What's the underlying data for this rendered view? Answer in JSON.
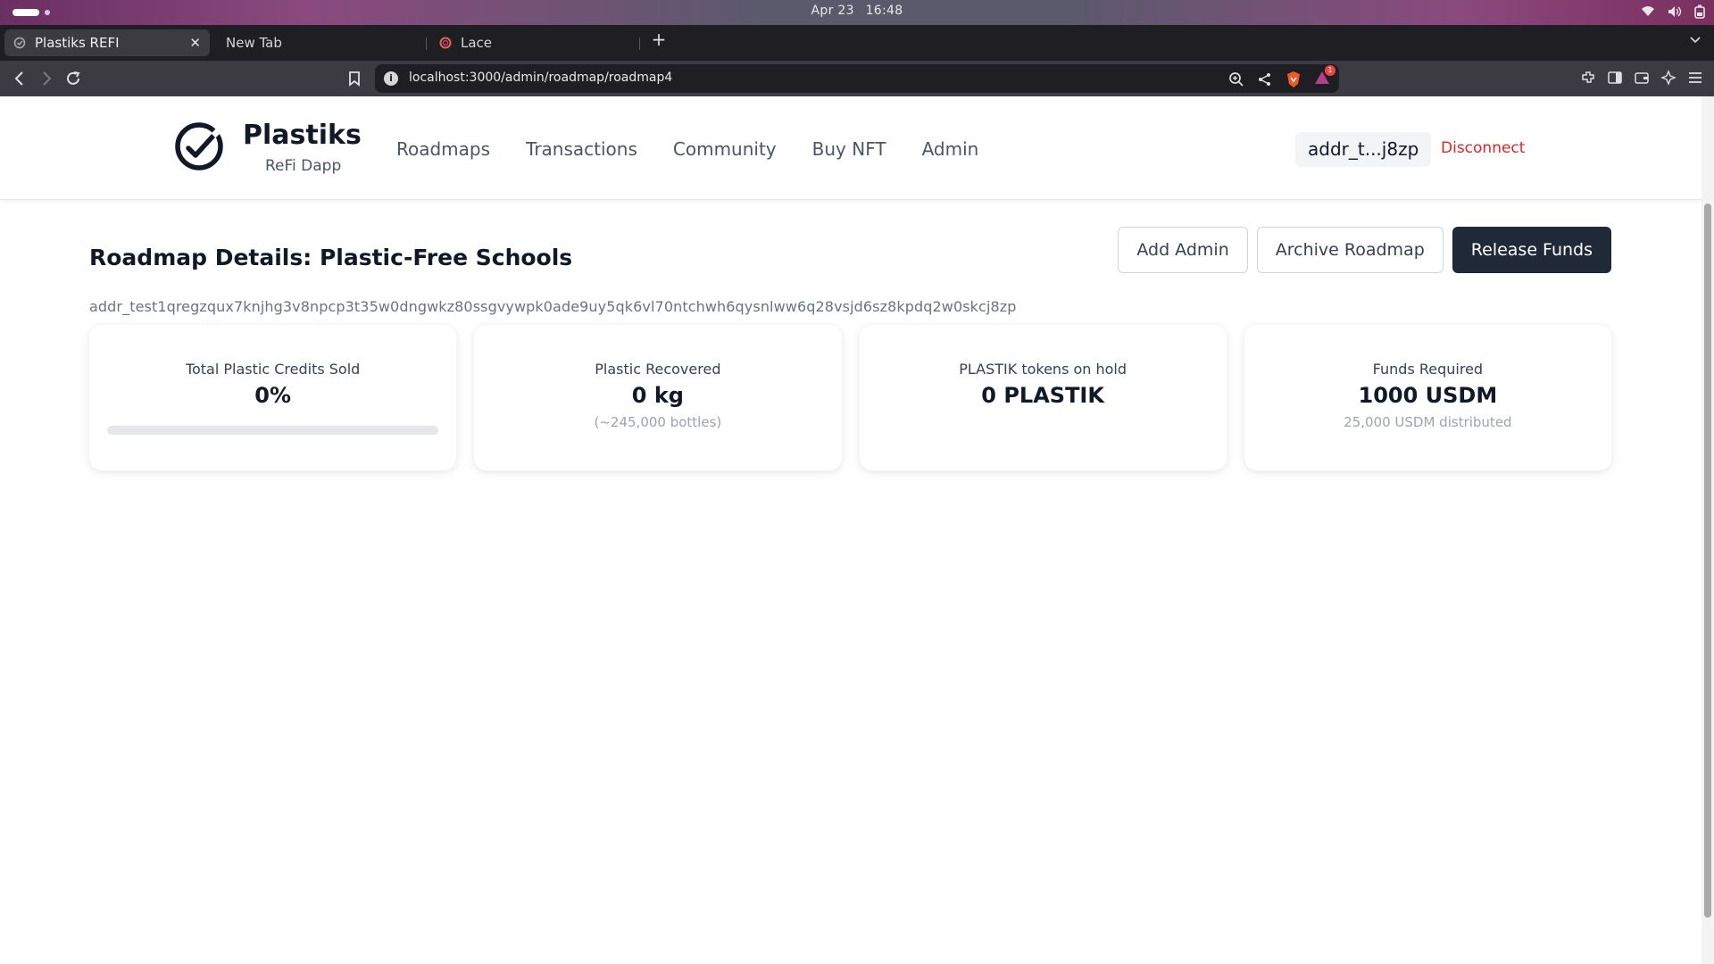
{
  "os": {
    "date": "Apr 23",
    "time": "16:48"
  },
  "browser": {
    "tabs": [
      {
        "title": "Plastiks REFI",
        "active": true
      },
      {
        "title": "New Tab",
        "active": false
      },
      {
        "title": "Lace",
        "active": false
      }
    ],
    "url": "localhost:3000/admin/roadmap/roadmap4",
    "notification_count": "1"
  },
  "header": {
    "brand": "Plastiks",
    "subtitle": "ReFi Dapp",
    "nav": [
      "Roadmaps",
      "Transactions",
      "Community",
      "Buy NFT",
      "Admin"
    ],
    "wallet": "addr_t...j8zp",
    "disconnect": "Disconnect"
  },
  "page": {
    "title": "Roadmap Details: Plastic-Free Schools",
    "address": "addr_test1qregzqux7knjhg3v8npcp3t35w0dngwkz80ssgvywpk0ade9uy5qk6vl70ntchwh6qysnlww6q28vsjd6sz8kpdq2w0skcj8zp",
    "buttons": {
      "add_admin": "Add Admin",
      "archive": "Archive Roadmap",
      "release": "Release Funds"
    }
  },
  "cards": [
    {
      "label": "Total Plastic Credits Sold",
      "value": "0%",
      "progress": 0
    },
    {
      "label": "Plastic Recovered",
      "value": "0 kg",
      "sub": "(~245,000 bottles)"
    },
    {
      "label": "PLASTIK tokens on hold",
      "value": "0 PLASTIK"
    },
    {
      "label": "Funds Required",
      "value": "1000 USDM",
      "sub": "25,000 USDM distributed"
    }
  ],
  "colors": {
    "primary": "#1f2937",
    "danger": "#dc2626",
    "muted": "#6b7280"
  }
}
